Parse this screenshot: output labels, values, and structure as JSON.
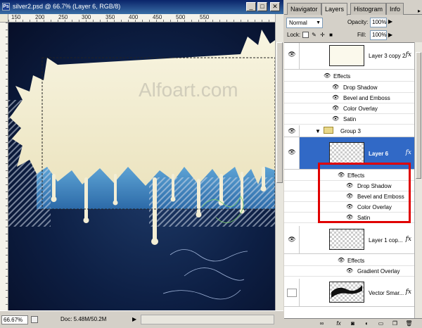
{
  "window": {
    "app_icon": "Ps",
    "title": "silver2.psd @ 66.7% (Layer 6, RGB/8)",
    "buttons": {
      "minimize": "_",
      "maximize": "□",
      "close": "✕"
    }
  },
  "ruler": {
    "ticks": [
      "150",
      "200",
      "250",
      "300",
      "350",
      "400",
      "450",
      "500",
      "550"
    ]
  },
  "canvas": {
    "watermark": "Alfoart.com"
  },
  "status": {
    "zoom": "66.67%",
    "doc": "Doc: 5.48M/50.2M",
    "arrow": "▶"
  },
  "panel": {
    "tabs": [
      "Navigator",
      "Layers",
      "Histogram",
      "Info"
    ],
    "active_tab": "Layers",
    "blend_mode": "Normal",
    "opacity_label": "Opacity:",
    "opacity": "100%",
    "lock_label": "Lock:",
    "fill_label": "Fill:",
    "fill": "100%",
    "layers": [
      {
        "name": "Layer 3 copy 2",
        "fx": "fx",
        "effects_label": "Effects",
        "effects": [
          "Drop Shadow",
          "Bevel and Emboss",
          "Color Overlay",
          "Satin"
        ]
      },
      {
        "name": "Group 3"
      },
      {
        "name": "Layer 6",
        "fx": "fx",
        "selected": true,
        "effects_label": "Effects",
        "effects": [
          "Drop Shadow",
          "Bevel and Emboss",
          "Color Overlay",
          "Satin"
        ]
      },
      {
        "name": "Layer 1 cop...",
        "fx": "fx",
        "effects_label": "Effects",
        "effects": [
          "Gradient Overlay"
        ]
      },
      {
        "name": "Vector Smar...",
        "fx": "fx"
      }
    ],
    "bottom_icons": [
      "link-icon",
      "fx-icon",
      "mask-icon",
      "adjustment-icon",
      "folder-icon",
      "new-layer-icon",
      "trash-icon"
    ]
  },
  "colors": {
    "selection": "#3169c6",
    "highlight_box": "#e00000",
    "title_bar": "#0a246a"
  }
}
